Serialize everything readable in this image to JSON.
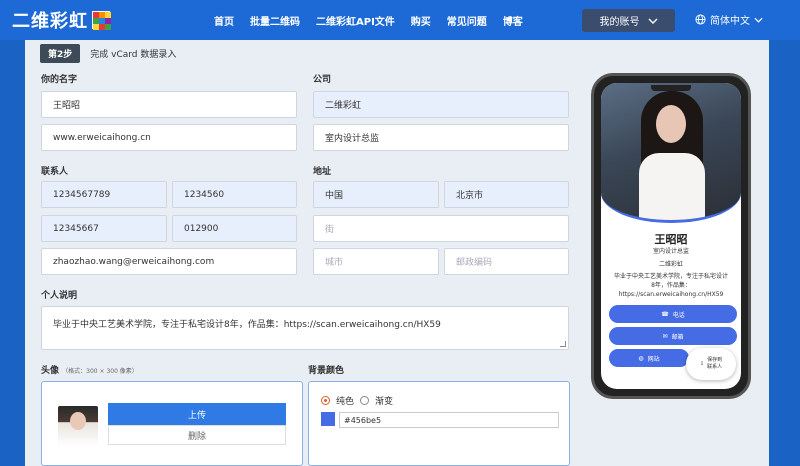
{
  "brand": {
    "name": "二维彩虹"
  },
  "nav": [
    "首页",
    "批量二维码",
    "二维彩虹API文件",
    "购买",
    "常见问题",
    "博客"
  ],
  "account": {
    "label": "我的账号"
  },
  "language": {
    "label": "简体中文"
  },
  "step": {
    "badge": "第2步",
    "title": "完成 vCard 数据录入"
  },
  "form": {
    "name_label": "你的名字",
    "name": "王昭昭",
    "website": "www.erweicaihong.cn",
    "company_label": "公司",
    "company": "二维彩虹",
    "title": "室内设计总监",
    "contact_label": "联系人",
    "mobile": "1234567789",
    "phone": "1234560",
    "fax": "12345667",
    "ext": "012900",
    "email": "zhaozhao.wang@erweicaihong.com",
    "address_label": "地址",
    "country": "中国",
    "city_region": "北京市",
    "street_ph": "街",
    "city_ph": "城市",
    "zip_ph": "邮政编码",
    "bio_label": "个人说明",
    "bio": "毕业于中央工艺美术学院，专注于私宅设计8年，作品集：https://scan.erweicaihong.cn/HX59",
    "avatar_label": "头像",
    "avatar_hint": "（格式：300 × 300 像素）",
    "upload": "上传",
    "delete": "删除",
    "bg_label": "背景颜色",
    "solid": "纯色",
    "gradient": "渐变",
    "color_value": "#456be5"
  },
  "preview": {
    "name": "王昭昭",
    "title": "室内设计总监",
    "company": "二维彩虹",
    "bio1": "毕业于中央工艺美术学院，专注于私宅设计",
    "bio2": "8年，作品集：",
    "bio3": "https://scan.erweicaihong.cn/HX59",
    "btn_phone": "电话",
    "btn_email": "邮箱",
    "btn_web": "网站",
    "save1": "保存到",
    "save2": "联系人"
  },
  "colors": {
    "accent": "#456be5",
    "topbar": "#1d6ad6"
  }
}
